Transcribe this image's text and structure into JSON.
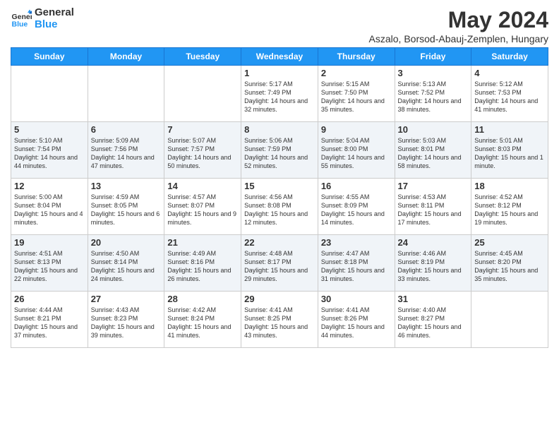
{
  "logo": {
    "line1": "General",
    "line2": "Blue"
  },
  "title": "May 2024",
  "subtitle": "Aszalo, Borsod-Abauj-Zemplen, Hungary",
  "days": [
    "Sunday",
    "Monday",
    "Tuesday",
    "Wednesday",
    "Thursday",
    "Friday",
    "Saturday"
  ],
  "weeks": [
    [
      {
        "date": "",
        "sunrise": "",
        "sunset": "",
        "daylight": ""
      },
      {
        "date": "",
        "sunrise": "",
        "sunset": "",
        "daylight": ""
      },
      {
        "date": "",
        "sunrise": "",
        "sunset": "",
        "daylight": ""
      },
      {
        "date": "1",
        "sunrise": "Sunrise: 5:17 AM",
        "sunset": "Sunset: 7:49 PM",
        "daylight": "Daylight: 14 hours and 32 minutes."
      },
      {
        "date": "2",
        "sunrise": "Sunrise: 5:15 AM",
        "sunset": "Sunset: 7:50 PM",
        "daylight": "Daylight: 14 hours and 35 minutes."
      },
      {
        "date": "3",
        "sunrise": "Sunrise: 5:13 AM",
        "sunset": "Sunset: 7:52 PM",
        "daylight": "Daylight: 14 hours and 38 minutes."
      },
      {
        "date": "4",
        "sunrise": "Sunrise: 5:12 AM",
        "sunset": "Sunset: 7:53 PM",
        "daylight": "Daylight: 14 hours and 41 minutes."
      }
    ],
    [
      {
        "date": "5",
        "sunrise": "Sunrise: 5:10 AM",
        "sunset": "Sunset: 7:54 PM",
        "daylight": "Daylight: 14 hours and 44 minutes."
      },
      {
        "date": "6",
        "sunrise": "Sunrise: 5:09 AM",
        "sunset": "Sunset: 7:56 PM",
        "daylight": "Daylight: 14 hours and 47 minutes."
      },
      {
        "date": "7",
        "sunrise": "Sunrise: 5:07 AM",
        "sunset": "Sunset: 7:57 PM",
        "daylight": "Daylight: 14 hours and 50 minutes."
      },
      {
        "date": "8",
        "sunrise": "Sunrise: 5:06 AM",
        "sunset": "Sunset: 7:59 PM",
        "daylight": "Daylight: 14 hours and 52 minutes."
      },
      {
        "date": "9",
        "sunrise": "Sunrise: 5:04 AM",
        "sunset": "Sunset: 8:00 PM",
        "daylight": "Daylight: 14 hours and 55 minutes."
      },
      {
        "date": "10",
        "sunrise": "Sunrise: 5:03 AM",
        "sunset": "Sunset: 8:01 PM",
        "daylight": "Daylight: 14 hours and 58 minutes."
      },
      {
        "date": "11",
        "sunrise": "Sunrise: 5:01 AM",
        "sunset": "Sunset: 8:03 PM",
        "daylight": "Daylight: 15 hours and 1 minute."
      }
    ],
    [
      {
        "date": "12",
        "sunrise": "Sunrise: 5:00 AM",
        "sunset": "Sunset: 8:04 PM",
        "daylight": "Daylight: 15 hours and 4 minutes."
      },
      {
        "date": "13",
        "sunrise": "Sunrise: 4:59 AM",
        "sunset": "Sunset: 8:05 PM",
        "daylight": "Daylight: 15 hours and 6 minutes."
      },
      {
        "date": "14",
        "sunrise": "Sunrise: 4:57 AM",
        "sunset": "Sunset: 8:07 PM",
        "daylight": "Daylight: 15 hours and 9 minutes."
      },
      {
        "date": "15",
        "sunrise": "Sunrise: 4:56 AM",
        "sunset": "Sunset: 8:08 PM",
        "daylight": "Daylight: 15 hours and 12 minutes."
      },
      {
        "date": "16",
        "sunrise": "Sunrise: 4:55 AM",
        "sunset": "Sunset: 8:09 PM",
        "daylight": "Daylight: 15 hours and 14 minutes."
      },
      {
        "date": "17",
        "sunrise": "Sunrise: 4:53 AM",
        "sunset": "Sunset: 8:11 PM",
        "daylight": "Daylight: 15 hours and 17 minutes."
      },
      {
        "date": "18",
        "sunrise": "Sunrise: 4:52 AM",
        "sunset": "Sunset: 8:12 PM",
        "daylight": "Daylight: 15 hours and 19 minutes."
      }
    ],
    [
      {
        "date": "19",
        "sunrise": "Sunrise: 4:51 AM",
        "sunset": "Sunset: 8:13 PM",
        "daylight": "Daylight: 15 hours and 22 minutes."
      },
      {
        "date": "20",
        "sunrise": "Sunrise: 4:50 AM",
        "sunset": "Sunset: 8:14 PM",
        "daylight": "Daylight: 15 hours and 24 minutes."
      },
      {
        "date": "21",
        "sunrise": "Sunrise: 4:49 AM",
        "sunset": "Sunset: 8:16 PM",
        "daylight": "Daylight: 15 hours and 26 minutes."
      },
      {
        "date": "22",
        "sunrise": "Sunrise: 4:48 AM",
        "sunset": "Sunset: 8:17 PM",
        "daylight": "Daylight: 15 hours and 29 minutes."
      },
      {
        "date": "23",
        "sunrise": "Sunrise: 4:47 AM",
        "sunset": "Sunset: 8:18 PM",
        "daylight": "Daylight: 15 hours and 31 minutes."
      },
      {
        "date": "24",
        "sunrise": "Sunrise: 4:46 AM",
        "sunset": "Sunset: 8:19 PM",
        "daylight": "Daylight: 15 hours and 33 minutes."
      },
      {
        "date": "25",
        "sunrise": "Sunrise: 4:45 AM",
        "sunset": "Sunset: 8:20 PM",
        "daylight": "Daylight: 15 hours and 35 minutes."
      }
    ],
    [
      {
        "date": "26",
        "sunrise": "Sunrise: 4:44 AM",
        "sunset": "Sunset: 8:21 PM",
        "daylight": "Daylight: 15 hours and 37 minutes."
      },
      {
        "date": "27",
        "sunrise": "Sunrise: 4:43 AM",
        "sunset": "Sunset: 8:23 PM",
        "daylight": "Daylight: 15 hours and 39 minutes."
      },
      {
        "date": "28",
        "sunrise": "Sunrise: 4:42 AM",
        "sunset": "Sunset: 8:24 PM",
        "daylight": "Daylight: 15 hours and 41 minutes."
      },
      {
        "date": "29",
        "sunrise": "Sunrise: 4:41 AM",
        "sunset": "Sunset: 8:25 PM",
        "daylight": "Daylight: 15 hours and 43 minutes."
      },
      {
        "date": "30",
        "sunrise": "Sunrise: 4:41 AM",
        "sunset": "Sunset: 8:26 PM",
        "daylight": "Daylight: 15 hours and 44 minutes."
      },
      {
        "date": "31",
        "sunrise": "Sunrise: 4:40 AM",
        "sunset": "Sunset: 8:27 PM",
        "daylight": "Daylight: 15 hours and 46 minutes."
      },
      {
        "date": "",
        "sunrise": "",
        "sunset": "",
        "daylight": ""
      }
    ]
  ]
}
